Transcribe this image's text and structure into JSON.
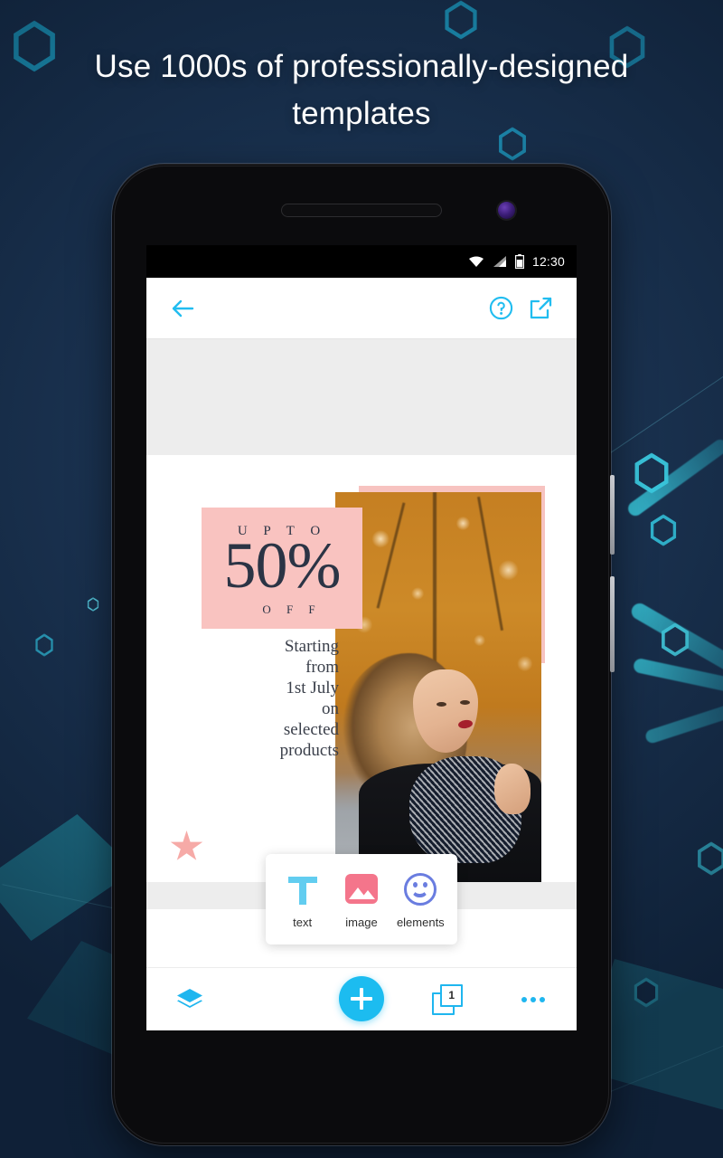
{
  "promo": {
    "headline": "Use 1000s of professionally-designed templates"
  },
  "colors": {
    "accent": "#1CBCF0",
    "bg_navy": "#1A3250",
    "pink": "#F9C3C0",
    "design_text": "#2B3445"
  },
  "phone": {
    "status_bar": {
      "time": "12:30",
      "icons": [
        "wifi-icon",
        "cellular-signal-icon",
        "battery-icon"
      ]
    },
    "app_bar": {
      "back_icon": "back-arrow-icon",
      "help_icon": "help-circle-icon",
      "share_icon": "share-external-icon"
    },
    "design": {
      "upto_label": "U P   T O",
      "discount": "50%",
      "off_label": "O F F",
      "details": "Starting\nfrom\n1st July\non\nselected\nproducts",
      "star": "star-shape"
    },
    "popup": {
      "items": [
        {
          "label": "text",
          "icon": "text-t-icon"
        },
        {
          "label": "image",
          "icon": "image-photo-icon"
        },
        {
          "label": "elements",
          "icon": "smiley-elements-icon"
        }
      ]
    },
    "bottom_bar": {
      "layers_icon": "layers-icon",
      "add_label": "+",
      "pages_count": "1",
      "overflow_icon": "more-options-icon"
    }
  }
}
